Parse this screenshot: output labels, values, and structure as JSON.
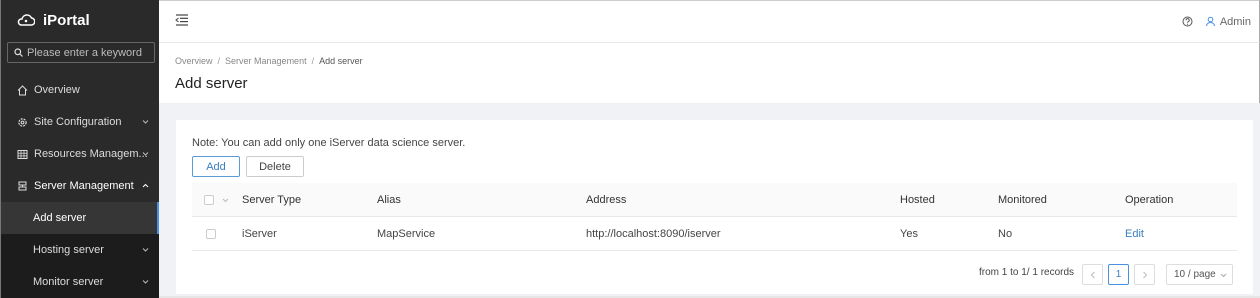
{
  "app": {
    "title": "iPortal"
  },
  "search": {
    "placeholder": "Please enter a keyword"
  },
  "sidebar": {
    "items": [
      {
        "label": "Overview",
        "icon": "home-icon"
      },
      {
        "label": "Site Configuration",
        "icon": "gear-icon"
      },
      {
        "label": "Resources Managem...",
        "icon": "grid-icon"
      },
      {
        "label": "Server Management",
        "icon": "server-icon"
      }
    ],
    "subitems": [
      {
        "label": "Add server",
        "active": true
      },
      {
        "label": "Hosting server"
      },
      {
        "label": "Monitor server"
      }
    ]
  },
  "topbar": {
    "user": "Admin"
  },
  "breadcrumb": {
    "level1": "Overview",
    "level2": "Server Management",
    "current": "Add server",
    "sep": "/"
  },
  "page": {
    "title": "Add server"
  },
  "card": {
    "note": "Note: You can add only one iServer data science server.",
    "add_label": "Add",
    "delete_label": "Delete"
  },
  "table": {
    "headers": [
      "Server Type",
      "Alias",
      "Address",
      "Hosted",
      "Monitored",
      "Operation"
    ],
    "rows": [
      {
        "type": "iServer",
        "alias": "MapService",
        "address": "http://localhost:8090/iserver",
        "hosted": "Yes",
        "monitored": "No",
        "operation": "Edit"
      }
    ]
  },
  "pagination": {
    "summary": "from 1 to 1/ 1 records",
    "current": "1",
    "page_size": "10 / page"
  },
  "colors": {
    "accent": "#3a7fc0",
    "sidebar_bg": "#2a2a2a"
  }
}
